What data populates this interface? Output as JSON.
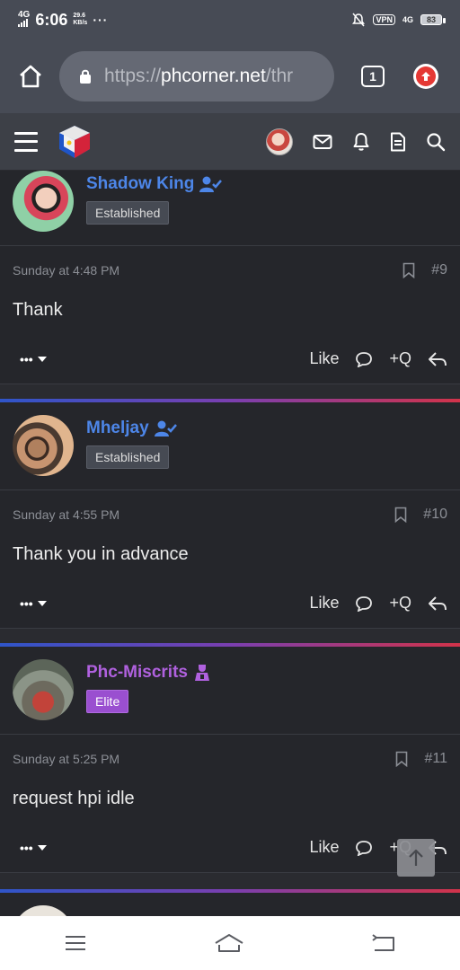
{
  "status_bar": {
    "network": "4G",
    "time": "6:06",
    "speed_value": "29.6",
    "speed_unit": "KB/s",
    "more": "···",
    "vpn": "VPN",
    "network_right": "4G",
    "battery": "83"
  },
  "browser": {
    "url_scheme": "https://",
    "url_host": "phcorner.net",
    "url_path": "/thr",
    "tab_count": "1"
  },
  "posts": [
    {
      "username": "Shadow King",
      "badge": "Established",
      "timestamp": "Sunday at 4:48 PM",
      "number": "#9",
      "body": "Thank",
      "like_label": "Like",
      "quote_label": "+Q"
    },
    {
      "username": "Mheljay",
      "badge": "Established",
      "timestamp": "Sunday at 4:55 PM",
      "number": "#10",
      "body": "Thank you in advance",
      "like_label": "Like",
      "quote_label": "+Q"
    },
    {
      "username": "Phc-Miscrits",
      "badge": "Elite",
      "timestamp": "Sunday at 5:25 PM",
      "number": "#11",
      "body": "request hpi idle",
      "like_label": "Like",
      "quote_label": "+Q"
    }
  ],
  "colors": {
    "username_blue": "#4d86e8",
    "username_elite": "#b061df",
    "elite_badge": "#9a4fd0",
    "separator_start": "#2f55c9",
    "separator_end": "#d2334a"
  }
}
